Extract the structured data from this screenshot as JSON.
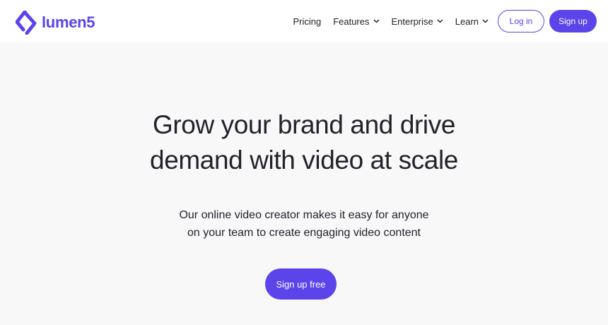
{
  "brand": {
    "name": "lumen5",
    "logo_icon": "lumen5-diamond-logo-icon",
    "accent_color": "#5a44ea"
  },
  "nav": {
    "items": [
      {
        "label": "Pricing",
        "has_dropdown": false
      },
      {
        "label": "Features",
        "has_dropdown": true
      },
      {
        "label": "Enterprise",
        "has_dropdown": true
      },
      {
        "label": "Learn",
        "has_dropdown": true
      }
    ],
    "login_label": "Log in",
    "signup_label": "Sign up"
  },
  "hero": {
    "headline_lines": [
      "Grow your brand and drive",
      "demand with video at scale"
    ],
    "subtitle_lines": [
      "Our online video creator makes it easy for anyone",
      "on your team to create engaging video content"
    ],
    "cta_label": "Sign up free"
  }
}
